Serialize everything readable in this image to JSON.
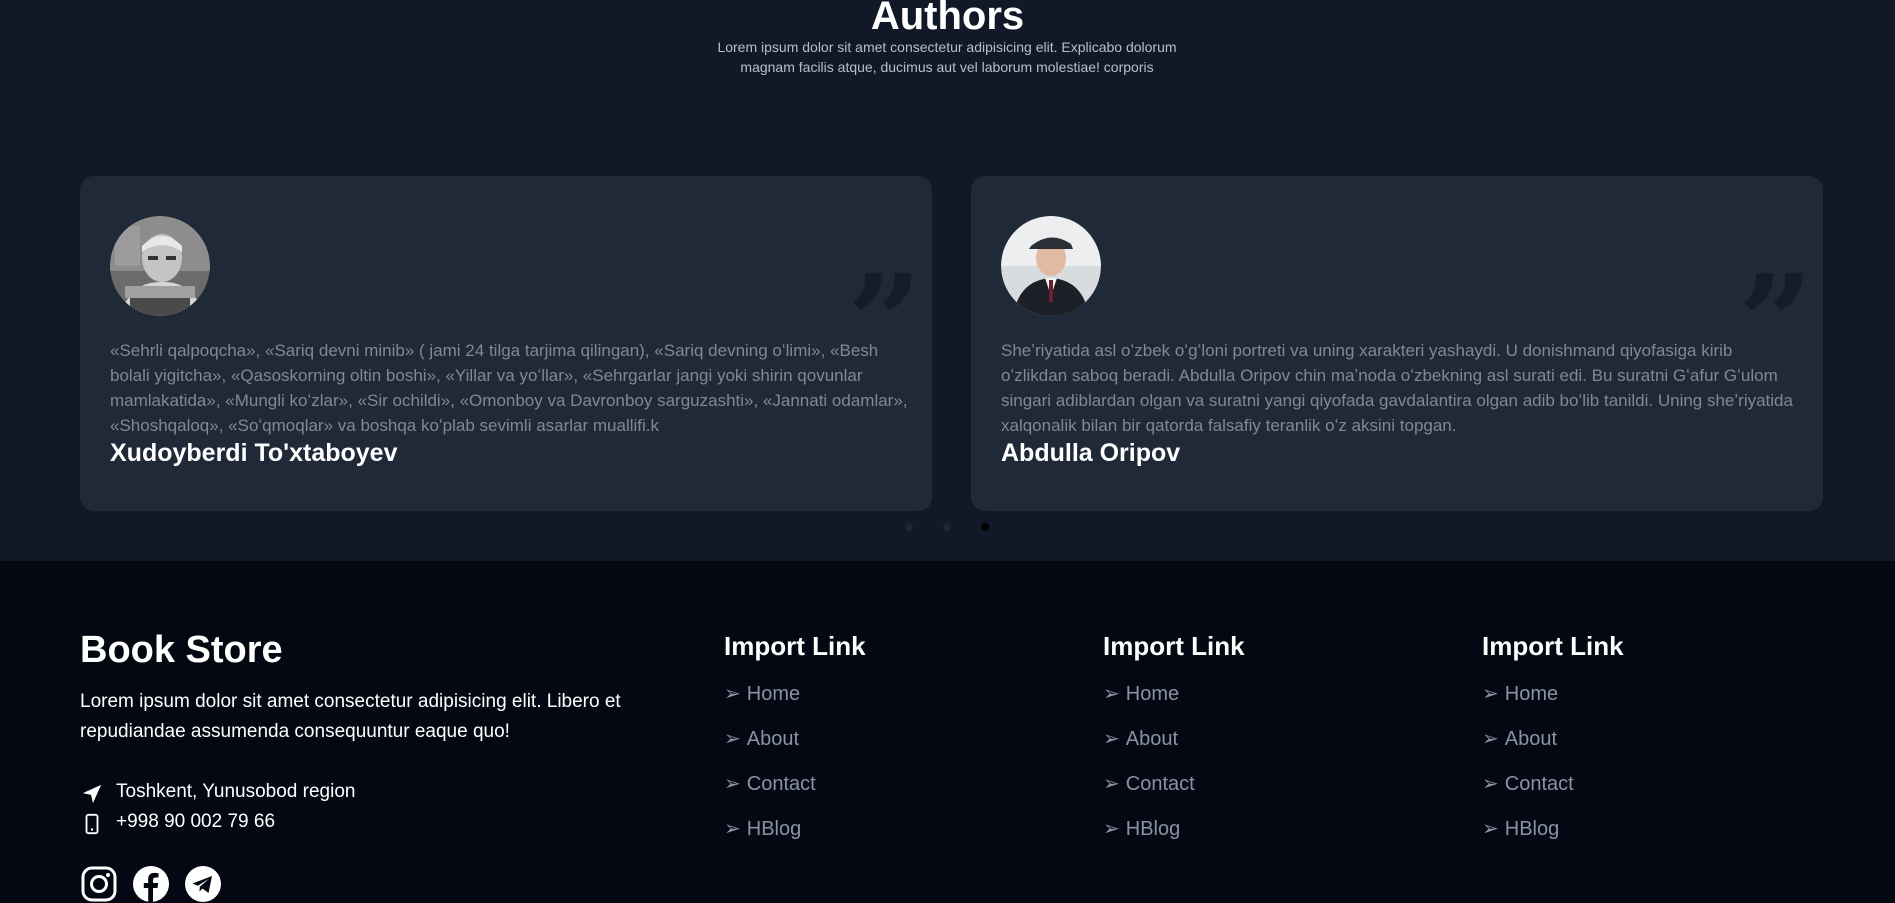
{
  "authors": {
    "title": "Authors",
    "description": "Lorem ipsum dolor sit amet consectetur adipisicing elit. Explicabo dolorum magnam facilis atque, ducimus aut vel laborum molestiae! corporis",
    "quote_glyph": "”",
    "cards": [
      {
        "avatar_icon": "author-photo",
        "text": "«Sehrli qalpoqcha», «Sariq devni minib» ( jami 24 tilga tarjima qilingan), «Sariq devning oʻlimi», «Besh bolali yigitcha», «Qasoskorning oltin boshi», «Yillar va yoʻllar», «Sehrgarlar jangi yoki shirin qovunlar mamlakatida», «Mungli koʻzlar», «Sir ochildi», «Omonboy va Davronboy sarguzashti», «Jannati odamlar», «Shoshqaloq», «Soʻqmoqlar» va boshqa koʻplab sevimli asarlar muallifi.k",
        "name": "Xudoyberdi To'xtaboyev"
      },
      {
        "avatar_icon": "author-photo",
        "text": "Sheʼriyatida asl oʻzbek oʻgʻloni portreti va uning xarakteri yashaydi. U donishmand qiyofasiga kirib oʻzlikdan saboq beradi. Abdulla Oripov chin maʼnoda oʻzbekning asl surati edi. Bu suratni Gʻafur Gʻulom singari adiblardan olgan va suratni yangi qiyofada gavdalantira olgan adib boʻlib tanildi. Uning sheʼriyatida xalqonalik bilan bir qatorda falsafiy teranlik oʻz aksini topgan.",
        "name": "Abdulla Oripov"
      }
    ],
    "carousel": {
      "pages": 3,
      "active_index": 2
    }
  },
  "footer": {
    "brand": "Book Store",
    "description": "Lorem ipsum dolor sit amet consectetur adipisicing elit. Libero et repudiandae assumenda consequuntur eaque quo!",
    "address": {
      "icon": "location-arrow-icon",
      "text": "Toshkent, Yunusobod region"
    },
    "phone": {
      "icon": "mobile-phone-icon",
      "text": "+998 90 002 79 66"
    },
    "socials": [
      "instagram-icon",
      "facebook-icon",
      "telegram-icon"
    ],
    "arrow_glyph": "➢",
    "columns": [
      {
        "title": "Import Link",
        "links": [
          "Home",
          "About",
          "Contact",
          "HBlog"
        ]
      },
      {
        "title": "Import Link",
        "links": [
          "Home",
          "About",
          "Contact",
          "HBlog"
        ]
      },
      {
        "title": "Import Link",
        "links": [
          "Home",
          "About",
          "Contact",
          "HBlog"
        ]
      }
    ],
    "colors": {
      "section_bg": "#111827",
      "card_bg": "#1f2937",
      "footer_bg": "#040812",
      "muted_text": "#808896"
    }
  }
}
